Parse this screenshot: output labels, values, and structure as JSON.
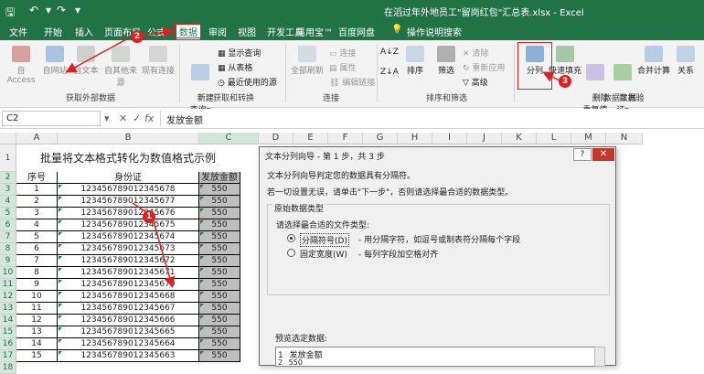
{
  "window": {
    "title": "在滔过年外地员工\"留岗红包\"汇总表.xlsx  -  Excel",
    "quick_access": [
      "save-icon",
      "undo-icon",
      "redo-icon",
      "customize-icon"
    ]
  },
  "menu_tabs": [
    "文件",
    "开始",
    "插入",
    "页面布局",
    "公式",
    "数据",
    "审阅",
    "视图",
    "开发工具",
    "易用宝™",
    "百度网盘",
    "操作说明搜索"
  ],
  "ribbon": {
    "get_external": {
      "buttons": [
        "自 Access",
        "自网站",
        "自文本",
        "自其他来源",
        "现有连接"
      ],
      "label": "获取外部数据"
    },
    "get_transform": {
      "new_query": "新建\n查询▾",
      "items": [
        "显示查询",
        "从表格",
        "最近使用的源"
      ],
      "label": "获取和转换"
    },
    "connections": {
      "refresh_all": "全部刷新",
      "items": [
        "连接",
        "属性",
        "编辑链接"
      ],
      "label": "连接"
    },
    "sort_filter": {
      "items": [
        "排序",
        "筛选"
      ],
      "small": [
        "清除",
        "重新应用",
        "高级"
      ],
      "label": "排序和筛选"
    },
    "data_tools": {
      "items": [
        "分列",
        "快速填充",
        "删除\n重复值",
        "数据验\n证▾",
        "合并计算",
        "关系"
      ],
      "label": "数据工具"
    }
  },
  "formula_bar": {
    "name_box": "C2",
    "cancel": "✕",
    "confirm": "✓",
    "fx": "fx",
    "value": "发放金额"
  },
  "sheet": {
    "columns": [
      "A",
      "B",
      "C",
      "D",
      "E",
      "F",
      "G",
      "H",
      "I",
      "J",
      "K",
      "L",
      "M",
      "N"
    ],
    "rows": [
      "1",
      "2",
      "3",
      "4",
      "5",
      "6",
      "7",
      "8",
      "9",
      "10",
      "11",
      "12",
      "13",
      "14",
      "15",
      "16",
      "17",
      "18"
    ],
    "title": "批量将文本格式转化为数值格式示例",
    "headers": [
      "序号",
      "身份证",
      "发放金额"
    ],
    "data": [
      [
        "1",
        "123456789012345678",
        "550"
      ],
      [
        "2",
        "123456789012345677",
        "550"
      ],
      [
        "3",
        "123456789012345676",
        "550"
      ],
      [
        "4",
        "123456789012345675",
        "550"
      ],
      [
        "5",
        "123456789012345674",
        "550"
      ],
      [
        "6",
        "123456789012345673",
        "550"
      ],
      [
        "7",
        "123456789012345672",
        "550"
      ],
      [
        "8",
        "123456789012345671",
        "550"
      ],
      [
        "9",
        "123456789012345670",
        "550"
      ],
      [
        "10",
        "123456789012345668",
        "550"
      ],
      [
        "11",
        "123456789012345667",
        "550"
      ],
      [
        "12",
        "123456789012345666",
        "550"
      ],
      [
        "13",
        "123456789012345665",
        "550"
      ],
      [
        "14",
        "123456789012345664",
        "550"
      ],
      [
        "15",
        "123456789012345663",
        "550"
      ]
    ]
  },
  "dialog": {
    "title": "文本分列向导 - 第 1 步，共 3 步",
    "help": "?",
    "close": "✕",
    "line1": "文本分列向导判定您的数据具有分隔符。",
    "line2": "若一切设置无误，请单击\"下一步\"，否则请选择最合适的数据类型。",
    "group_title": "原始数据类型",
    "choose_label": "请选择最合适的文件类型:",
    "option1_label": "分隔符号(D)",
    "option1_desc": "- 用分隔字符，如逗号或制表符分隔每个字段",
    "option2_label": "固定宽度(W)",
    "option2_desc": "- 每列字段加空格对齐",
    "preview_label": "预览选定数据:",
    "preview_rows": [
      {
        "num": "1",
        "text": "发放金额"
      },
      {
        "num": "2",
        "text": "550"
      }
    ]
  },
  "annotations": {
    "badges": [
      "1",
      "2",
      "3"
    ],
    "accent": "#e02020"
  },
  "colors": {
    "excel_green": "#217346",
    "ribbon_bg": "#f3f3f3",
    "selected_col_bg": "#bfbfbf"
  }
}
